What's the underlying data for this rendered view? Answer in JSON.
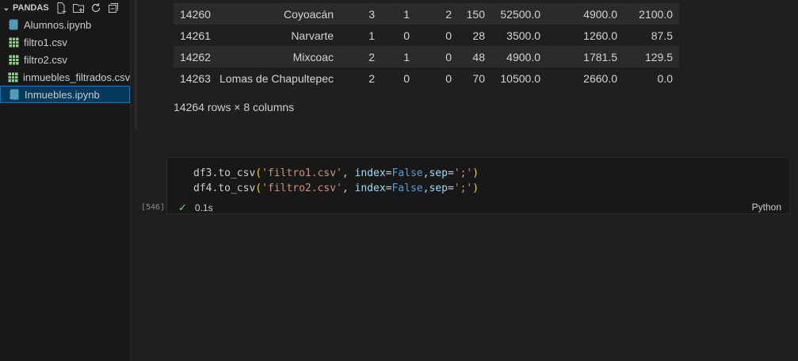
{
  "explorer": {
    "folder": "PANDAS",
    "files": [
      {
        "name": "Alumnos.ipynb",
        "icon": "notebook-icon",
        "selected": false
      },
      {
        "name": "filtro1.csv",
        "icon": "csv-icon",
        "selected": false
      },
      {
        "name": "filtro2.csv",
        "icon": "csv-icon",
        "selected": false
      },
      {
        "name": "inmuebles_filtrados.csv",
        "icon": "csv-icon",
        "selected": false
      },
      {
        "name": "Inmuebles.ipynb",
        "icon": "notebook-icon",
        "selected": true
      }
    ]
  },
  "dataframe": {
    "rows": [
      [
        "14260",
        "Coyoacán",
        "3",
        "1",
        "2",
        "150",
        "52500.0",
        "4900.0",
        "2100.0"
      ],
      [
        "14261",
        "Narvarte",
        "1",
        "0",
        "0",
        "28",
        "3500.0",
        "1260.0",
        "87.5"
      ],
      [
        "14262",
        "Mixcoac",
        "2",
        "1",
        "0",
        "48",
        "4900.0",
        "1781.5",
        "129.5"
      ],
      [
        "14263",
        "Lomas de Chapultepec",
        "2",
        "0",
        "0",
        "70",
        "10500.0",
        "2660.0",
        "0.0"
      ]
    ],
    "shape": "14264 rows × 8 columns"
  },
  "cell": {
    "execution_count": "[546]",
    "lines": [
      {
        "obj": "df3",
        "file": "'filtro1.csv'"
      },
      {
        "obj": "df4",
        "file": "'filtro2.csv'"
      }
    ],
    "method": ".to_csv",
    "param_index": "index",
    "value_false": "False",
    "param_sep": "sep",
    "sep_value": "';'",
    "duration": "0.1s",
    "language": "Python"
  },
  "colors": {
    "background": "#1f1f1f",
    "sidebar": "#181818",
    "selection": "#04395e",
    "focus_border": "#0078d4",
    "success": "#89d185"
  }
}
